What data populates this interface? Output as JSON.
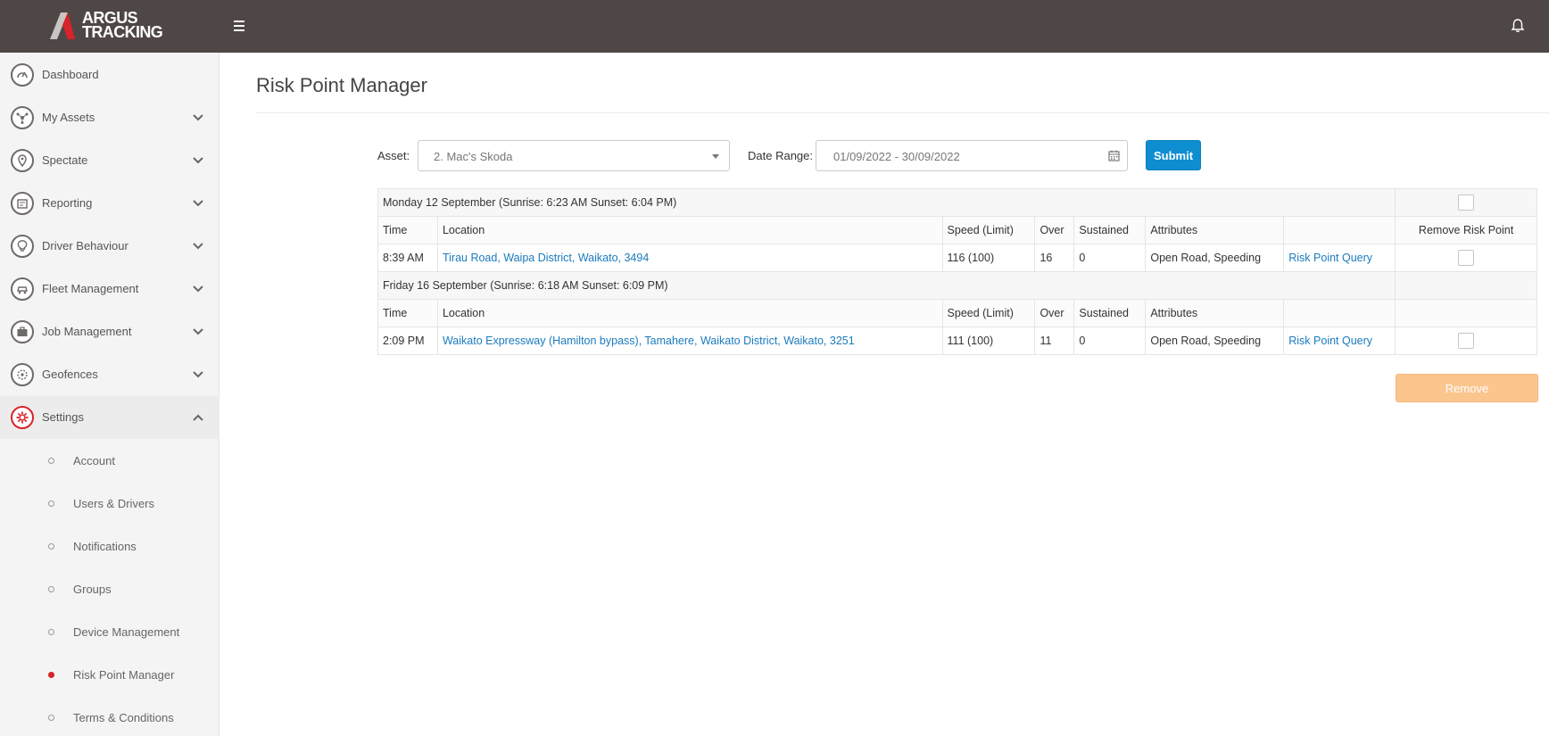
{
  "brand": {
    "line1": "ARGUS",
    "line2": "TRACKING",
    "accent": "#d8232a"
  },
  "topbar": {
    "bg": "#4e4745",
    "menu_icon": "hamburger-icon",
    "notification_icon": "bell-icon"
  },
  "sidebar": {
    "items": [
      {
        "label": "Dashboard",
        "icon": "dashboard-icon",
        "has_chevron": false
      },
      {
        "label": "My Assets",
        "icon": "assets-icon",
        "has_chevron": true
      },
      {
        "label": "Spectate",
        "icon": "map-pin-icon",
        "has_chevron": true
      },
      {
        "label": "Reporting",
        "icon": "report-icon",
        "has_chevron": true
      },
      {
        "label": "Driver Behaviour",
        "icon": "lightbulb-icon",
        "has_chevron": true
      },
      {
        "label": "Fleet Management",
        "icon": "car-icon",
        "has_chevron": true
      },
      {
        "label": "Job Management",
        "icon": "briefcase-icon",
        "has_chevron": true
      },
      {
        "label": "Geofences",
        "icon": "geofence-icon",
        "has_chevron": true
      },
      {
        "label": "Settings",
        "icon": "gear-icon",
        "has_chevron": true,
        "expanded": true,
        "active": true
      }
    ],
    "settings_children": [
      {
        "label": "Account"
      },
      {
        "label": "Users & Drivers"
      },
      {
        "label": "Notifications"
      },
      {
        "label": "Groups"
      },
      {
        "label": "Device Management"
      },
      {
        "label": "Risk Point Manager",
        "active": true
      },
      {
        "label": "Terms & Conditions"
      }
    ]
  },
  "page": {
    "title": "Risk Point Manager"
  },
  "filters": {
    "asset_label": "Asset:",
    "asset_value": "2. Mac's Skoda",
    "date_label": "Date Range:",
    "date_value": "01/09/2022 - 30/09/2022",
    "submit_label": "Submit"
  },
  "table": {
    "columns": [
      "Time",
      "Location",
      "Speed (Limit)",
      "Over",
      "Sustained",
      "Attributes",
      "",
      "Remove Risk Point"
    ],
    "groups": [
      {
        "day": "Monday 12 September (Sunrise: 6:23 AM Sunset: 6:04 PM)",
        "rows": [
          {
            "time": "8:39 AM",
            "location": "Tirau Road, Waipa District, Waikato, 3494",
            "speed": "116 (100)",
            "over": "16",
            "sustained": "0",
            "attributes": "Open Road, Speeding",
            "query": "Risk Point Query"
          }
        ]
      },
      {
        "day": "Friday 16 September (Sunrise: 6:18 AM Sunset: 6:09 PM)",
        "rows": [
          {
            "time": "2:09 PM",
            "location": "Waikato Expressway (Hamilton bypass), Tamahere, Waikato District, Waikato, 3251",
            "speed": "111 (100)",
            "over": "11",
            "sustained": "0",
            "attributes": "Open Road, Speeding",
            "query": "Risk Point Query"
          }
        ]
      }
    ]
  },
  "actions": {
    "remove_label": "Remove"
  },
  "colors": {
    "primary": "#0e8ed0",
    "link": "#1b7bbd",
    "remove_bg": "#fbc58e",
    "active_red": "#d8232a"
  }
}
